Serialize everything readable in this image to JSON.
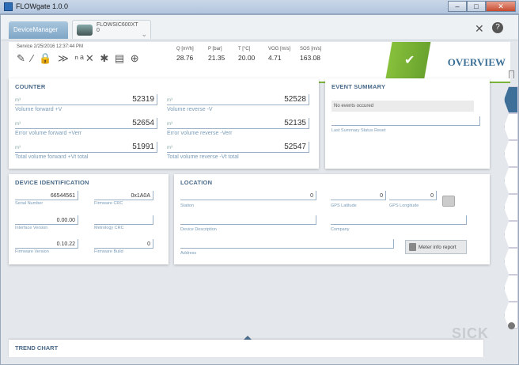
{
  "window": {
    "title": "FLOWgate 1.0.0",
    "minimize": "–",
    "maximize": "□",
    "close": "✕"
  },
  "tabs": [
    {
      "label": "DeviceManager"
    },
    {
      "label": "FLOWSIC600XT",
      "sub": "0"
    }
  ],
  "toolbar": {
    "tools_icon": "✕",
    "help_icon": "?"
  },
  "status": {
    "service": "Service 2/25/2016 12:37:44 PM",
    "icons": "✎ ⁄ 🔒 ≫ ⁿᵃ✕ ✱ ▤ ⊕",
    "measurements": [
      {
        "label": "Q [m³/h]",
        "value": "28.76"
      },
      {
        "label": "P [bar]",
        "value": "21.35"
      },
      {
        "label": "T [°C]",
        "value": "20.00"
      },
      {
        "label": "VOG [m/s]",
        "value": "4.71"
      },
      {
        "label": "SOS [m/s]",
        "value": "163.08"
      }
    ],
    "check": "✔",
    "overview": "OVERVIEW"
  },
  "counter": {
    "title": "COUNTER",
    "items": [
      {
        "unit": "m³",
        "value": "52319",
        "label": "Volume forward +V"
      },
      {
        "unit": "m³",
        "value": "52528",
        "label": "Volume reverse -V"
      },
      {
        "unit": "m³",
        "value": "52654",
        "label": "Error volume forward +Verr"
      },
      {
        "unit": "m³",
        "value": "52135",
        "label": "Error volume reverse -Verr"
      },
      {
        "unit": "m³",
        "value": "51991",
        "label": "Total volume forward +Vt total"
      },
      {
        "unit": "m³",
        "value": "52547",
        "label": "Total volume reverse -Vt total"
      }
    ]
  },
  "events": {
    "title": "EVENT SUMMARY",
    "none": "No events occured",
    "reset_label": "Last Summary Status Reset"
  },
  "device": {
    "title": "DEVICE IDENTIFICATION",
    "fields": [
      {
        "value": "66544561",
        "label": "Serial Number"
      },
      {
        "value": "0x1A0A",
        "label": "Firmware CRC"
      },
      {
        "value": "0.00.00",
        "label": "Interface Version"
      },
      {
        "value": "",
        "label": "Metrology CRC"
      },
      {
        "value": "0.10.22",
        "label": "Firmware Version"
      },
      {
        "value": "0",
        "label": "Firmware Build"
      }
    ]
  },
  "location": {
    "title": "LOCATION",
    "station_value": "0",
    "station_label": "Station",
    "lat_value": "0",
    "lat_label": "GPS Latitude",
    "lon_value": "0",
    "lon_label": "GPS Longitude",
    "desc_label": "Device Description",
    "company_label": "Company",
    "address_label": "Address",
    "report_button": "Meter info report"
  },
  "trend": {
    "title": "TREND CHART"
  },
  "brand": "SICK"
}
